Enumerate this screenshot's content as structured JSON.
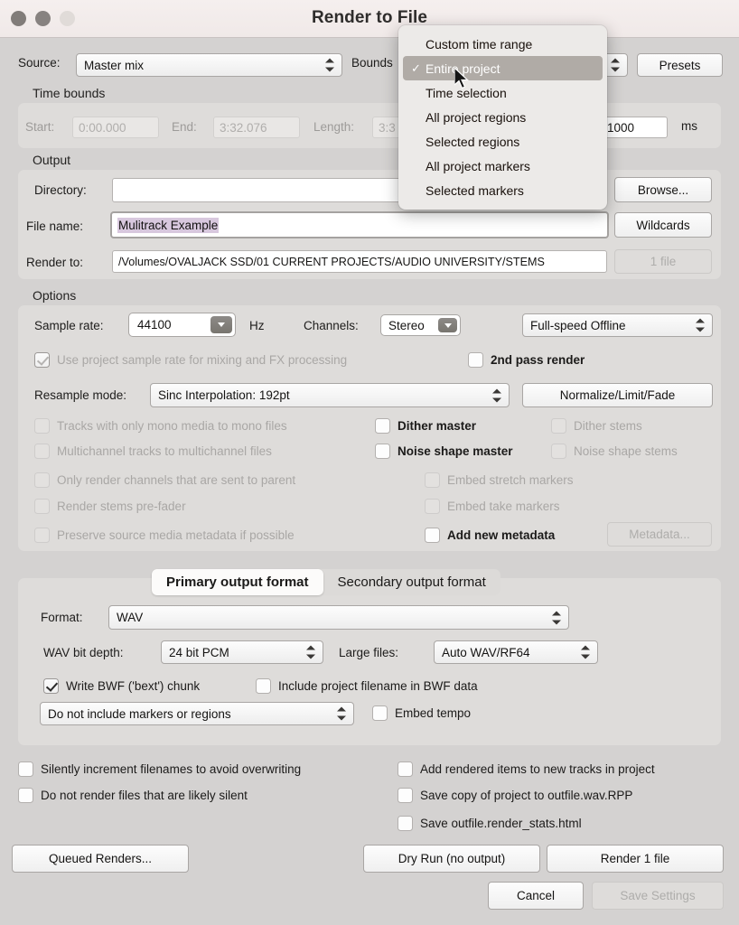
{
  "window": {
    "title": "Render to File",
    "traffic_lights": [
      "close-button",
      "minimize-button",
      "zoom-button"
    ]
  },
  "top": {
    "source_label": "Source:",
    "source_value": "Master mix",
    "bounds_label": "Bounds",
    "presets_label": "Presets"
  },
  "bounds_menu": {
    "items": [
      {
        "label": "Custom time range",
        "checked": false
      },
      {
        "label": "Entire project",
        "checked": true
      },
      {
        "label": "Time selection",
        "checked": false
      },
      {
        "label": "All project regions",
        "checked": false
      },
      {
        "label": "Selected regions",
        "checked": false
      },
      {
        "label": "All project markers",
        "checked": false
      },
      {
        "label": "Selected markers",
        "checked": false
      }
    ],
    "checkmark": "✓"
  },
  "time_bounds": {
    "group_label": "Time bounds",
    "start_label": "Start:",
    "start_value": "0:00.000",
    "end_label": "End:",
    "end_value": "3:32.076",
    "length_label": "Length:",
    "length_value": "3:3",
    "tail_value": "1000",
    "tail_unit": "ms"
  },
  "output": {
    "group_label": "Output",
    "directory_label": "Directory:",
    "directory_value": "",
    "browse_label": "Browse...",
    "filename_label": "File name:",
    "filename_value": "Mulitrack Example",
    "wildcards_label": "Wildcards",
    "render_to_label": "Render to:",
    "render_to_value": "/Volumes/OVALJACK SSD/01 CURRENT PROJECTS/AUDIO UNIVERSITY/STEMS",
    "file_count_label": "1 file"
  },
  "options": {
    "group_label": "Options",
    "sample_rate_label": "Sample rate:",
    "sample_rate_value": "44100",
    "hz_label": "Hz",
    "channels_label": "Channels:",
    "channels_value": "Stereo",
    "speed_value": "Full-speed Offline",
    "use_project_sr_label": "Use project sample rate for mixing and FX processing",
    "second_pass_label": "2nd pass render",
    "resample_label": "Resample mode:",
    "resample_value": "Sinc Interpolation: 192pt",
    "normalize_label": "Normalize/Limit/Fade",
    "checkboxes": [
      {
        "label": "Tracks with only mono media to mono files",
        "checked": false,
        "enabled": false
      },
      {
        "label": "Dither master",
        "checked": false,
        "enabled": true
      },
      {
        "label": "Dither stems",
        "checked": false,
        "enabled": false
      },
      {
        "label": "Multichannel tracks to multichannel files",
        "checked": false,
        "enabled": false
      },
      {
        "label": "Noise shape master",
        "checked": false,
        "enabled": true
      },
      {
        "label": "Noise shape stems",
        "checked": false,
        "enabled": false
      },
      {
        "label": "Only render channels that are sent to parent",
        "checked": false,
        "enabled": false
      },
      {
        "label": "Embed stretch markers",
        "checked": false,
        "enabled": false
      },
      {
        "label": "Render stems pre-fader",
        "checked": false,
        "enabled": false
      },
      {
        "label": "Embed take markers",
        "checked": false,
        "enabled": false
      },
      {
        "label": "Preserve source media metadata if possible",
        "checked": false,
        "enabled": false
      },
      {
        "label": "Add new metadata",
        "checked": false,
        "enabled": true
      }
    ],
    "metadata_button": "Metadata..."
  },
  "format_tabs": {
    "primary": "Primary output format",
    "secondary": "Secondary output format"
  },
  "format": {
    "format_label": "Format:",
    "format_value": "WAV",
    "bit_depth_label": "WAV bit depth:",
    "bit_depth_value": "24 bit PCM",
    "large_files_label": "Large files:",
    "large_files_value": "Auto WAV/RF64",
    "write_bwf_label": "Write BWF ('bext') chunk",
    "include_project_filename_label": "Include project filename in BWF data",
    "markers_value": "Do not include markers or regions",
    "embed_tempo_label": "Embed tempo"
  },
  "bottom_options": {
    "left": [
      "Silently increment filenames to avoid overwriting",
      "Do not render files that are likely silent"
    ],
    "right": [
      "Add rendered items to new tracks in project",
      "Save copy of project to outfile.wav.RPP",
      "Save outfile.render_stats.html"
    ]
  },
  "actions": {
    "queued_renders": "Queued Renders...",
    "dry_run": "Dry Run (no output)",
    "render": "Render 1 file",
    "cancel": "Cancel",
    "save_settings": "Save Settings"
  },
  "colors": {
    "window_bg": "#d4d2d1",
    "titlebar": "#f2ebea",
    "panel": "#dedcda",
    "menu_highlight": "#b0aba6",
    "selection": "#d8c8de"
  }
}
